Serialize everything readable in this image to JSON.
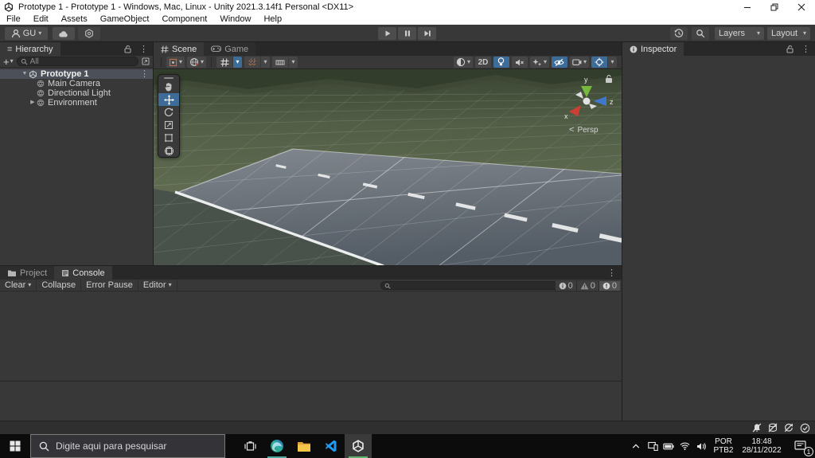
{
  "window": {
    "title": "Prototype 1 - Prototype 1 - Windows, Mac, Linux - Unity 2021.3.14f1 Personal <DX11>"
  },
  "menu": {
    "items": [
      "File",
      "Edit",
      "Assets",
      "GameObject",
      "Component",
      "Window",
      "Help"
    ]
  },
  "toolbar": {
    "account_label": "GU",
    "layers_label": "Layers",
    "layout_label": "Layout"
  },
  "hierarchy": {
    "tab_label": "Hierarchy",
    "search_placeholder": "All",
    "root": {
      "label": "Prototype 1"
    },
    "items": [
      {
        "label": "Main Camera"
      },
      {
        "label": "Directional Light"
      },
      {
        "label": "Environment"
      }
    ]
  },
  "scene_view": {
    "tab_scene": "Scene",
    "tab_game": "Game",
    "toggle_2d": "2D",
    "projection_label": "Persp",
    "axes": {
      "x": "x",
      "y": "y",
      "z": "z"
    }
  },
  "inspector": {
    "tab_label": "Inspector"
  },
  "console": {
    "tab_project": "Project",
    "tab_console": "Console",
    "clear_label": "Clear",
    "collapse_label": "Collapse",
    "error_pause_label": "Error Pause",
    "editor_label": "Editor",
    "info_count": "0",
    "warning_count": "0",
    "error_count": "0"
  },
  "taskbar": {
    "search_placeholder": "Digite aqui para pesquisar",
    "tray": {
      "lang_primary": "POR",
      "lang_secondary": "PTB2",
      "time": "18:48",
      "date": "28/11/2022",
      "notification_count": "1"
    }
  },
  "icons": {
    "chevron_down": "▾",
    "chevron_left": "<",
    "kebab": "⋮",
    "hamburger": "≡",
    "expander_open": "▼",
    "expander_closed": "▶",
    "plus": "+"
  },
  "colors": {
    "accent_blue": "#3d6c99",
    "selection_gray": "#4c5059",
    "panel_bg": "#383838",
    "chrome_bg": "#282828",
    "taskbar_bg": "#0c0c0c",
    "edge_underline": "#4fa8a0",
    "unity_underline": "#62b36a"
  }
}
